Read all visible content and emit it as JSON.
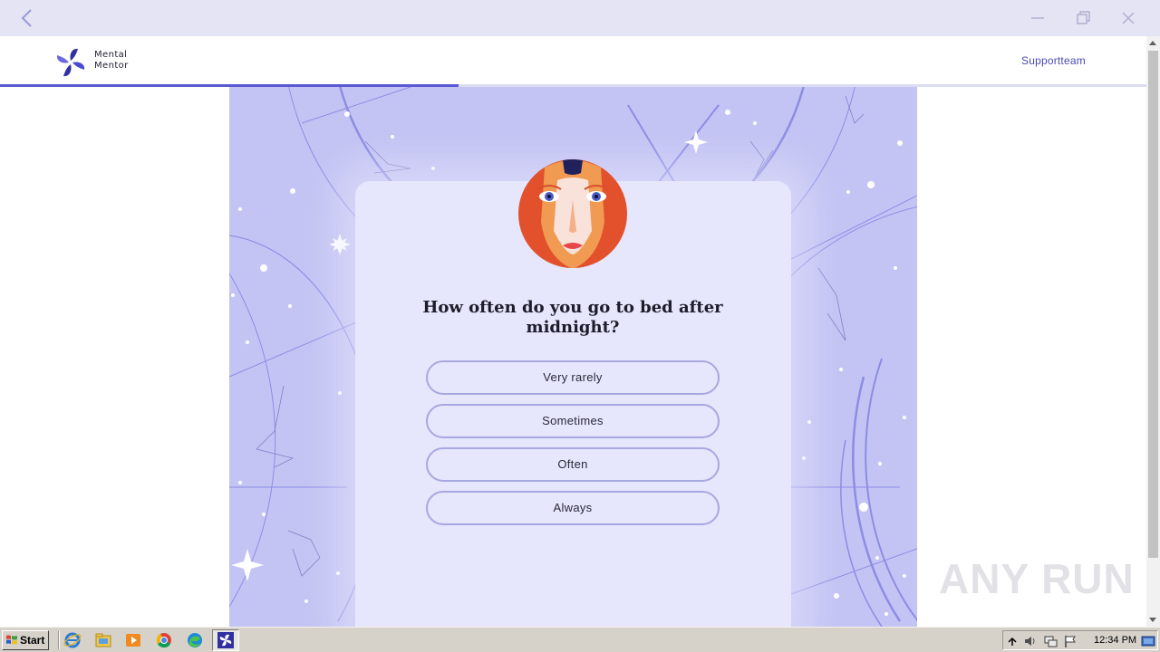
{
  "app": {
    "brand_line1": "Mental",
    "brand_line2": "Mentor",
    "support_link": "Supportteam",
    "progress": 0.4
  },
  "quiz": {
    "question": "How often do you go to bed after midnight?",
    "options": [
      "Very rarely",
      "Sometimes",
      "Often",
      "Always"
    ]
  },
  "watermark": "ANY RUN",
  "taskbar": {
    "start_label": "Start",
    "pinned_icons": [
      "internet-explorer-icon",
      "file-explorer-icon",
      "media-player-icon",
      "chrome-icon",
      "edge-icon",
      "mental-mentor-app-icon"
    ],
    "clock": "12:34 PM"
  },
  "colors": {
    "accent": "#5a5ad2",
    "stage_bg": "#c4c4f4",
    "card_bg": "#e6e6fc",
    "option_border": "#a8a8e0"
  }
}
